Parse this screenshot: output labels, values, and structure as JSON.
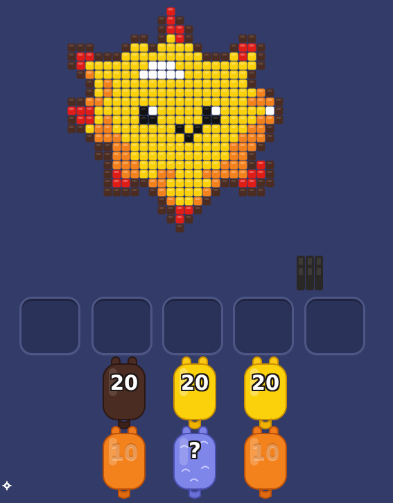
{
  "palette": {
    "background": "#333b68",
    "brown": "#4a2c22",
    "dark-brown": "#3a2018",
    "red": "#e01c16",
    "orange": "#f3811c",
    "light-orange": "#f7a41e",
    "yellow": "#fbd10c",
    "white": "#ffffff",
    "black": "#121212"
  },
  "pixel_art": {
    "subject": "sun-face",
    "rows": [
      "...........R.............",
      "..........BRB............",
      "..........BRRB...........",
      ".......BB.BYRB.....BB....",
      "BBB...BYYBYYYYB...BRRB...",
      "BRRBBBYYYYYYYYYBBBYRYB...",
      "BRYYYYYYYWWWYYYYYYYYYB...",
      ".BOYYYYYWWWWWYYYYYYYB....",
      "..BYOYYYYYYYYYYYYYYYB....",
      "..BYOYYYYYYYYYYYYYYYYOB..",
      "BBOOYYYYYYYYYYYYYYYYOOOB.",
      "RRRYYYYYKWYYYYYKWYYYYYWB.",
      "BRRYOYYYKKYYYYYKKYYYYOOB.",
      "BBYOOYYYYYYYKYKYYYYYOOB..",
      "..BOOOYYYYYYYKYYYYYOOOB..",
      "...BBOOYYYYYYYYYYYOOOB...",
      "...BBOOYYYYYYYYYYYOOB....",
      "....BOOOYYYYYYYYYOOOBRB..",
      "....BROOYYOOYYYOOOOORRB..",
      "....BRRBBOOYYYYYOBBRRBB..",
      "....BBBB.BOYYYYOB..BBB...",
      "..........BOYYOB.........",
      "..........BBRRB..........",
      "...........BRB...........",
      "............B............"
    ]
  },
  "mini_stack": {
    "color": "dark-brown",
    "count": 3
  },
  "slots": {
    "count": 5
  },
  "jars": [
    {
      "label": "20",
      "color": "brown",
      "state": "active"
    },
    {
      "label": "20",
      "color": "yellow",
      "state": "active"
    },
    {
      "label": "20",
      "color": "yellow",
      "state": "active"
    },
    {
      "label": "10",
      "color": "orange",
      "state": "locked"
    },
    {
      "label": "?",
      "color": "purple",
      "state": "mystery"
    },
    {
      "label": "10",
      "color": "orange",
      "state": "locked"
    }
  ]
}
